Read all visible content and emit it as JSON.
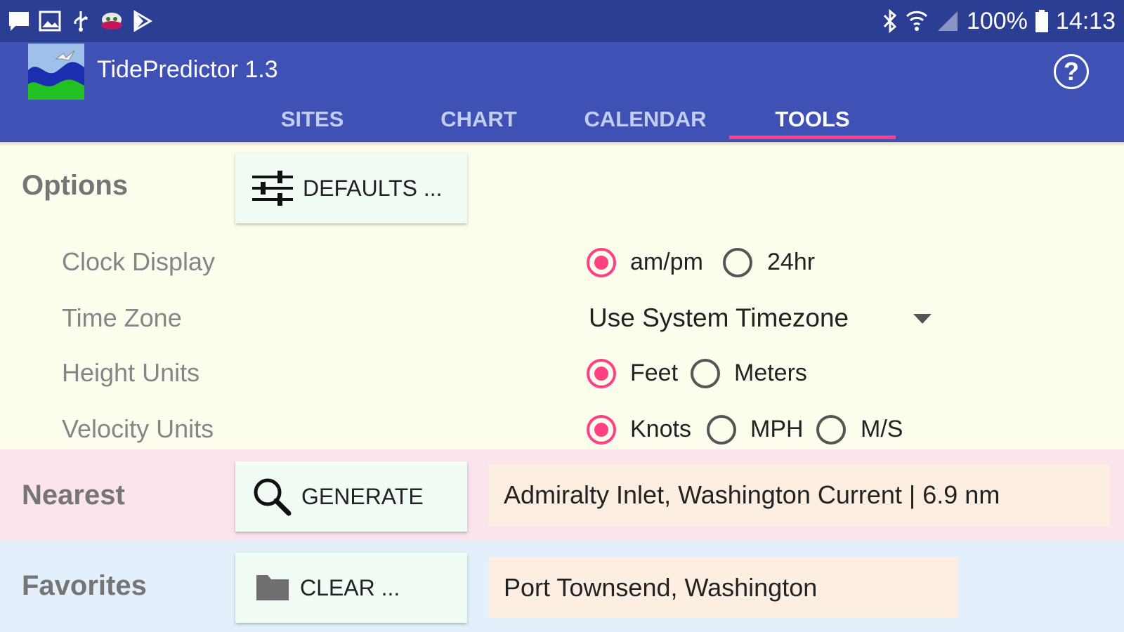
{
  "status_bar": {
    "battery": "100%",
    "time": "14:13",
    "left_icons": [
      "chat-icon",
      "image-icon",
      "usb-icon",
      "android-icon",
      "play-icon"
    ],
    "right_icons": [
      "bluetooth-icon",
      "wifi-icon",
      "signal-icon",
      "battery-icon"
    ]
  },
  "app_bar": {
    "title": "TidePredictor 1.3",
    "help_label": "?"
  },
  "tabs": [
    {
      "label": "SITES",
      "active": false
    },
    {
      "label": "CHART",
      "active": false
    },
    {
      "label": "CALENDAR",
      "active": false
    },
    {
      "label": "TOOLS",
      "active": true
    }
  ],
  "options": {
    "title": "Options",
    "defaults_button": "DEFAULTS ...",
    "clock_display": {
      "label": "Clock Display",
      "options": [
        "am/pm",
        "24hr"
      ],
      "selected": "am/pm"
    },
    "time_zone": {
      "label": "Time Zone",
      "value": "Use System Timezone"
    },
    "height_units": {
      "label": "Height Units",
      "options": [
        "Feet",
        "Meters"
      ],
      "selected": "Feet"
    },
    "velocity_units": {
      "label": "Velocity Units",
      "options": [
        "Knots",
        "MPH",
        "M/S"
      ],
      "selected": "Knots"
    }
  },
  "nearest": {
    "title": "Nearest",
    "button": "GENERATE",
    "result": "Admiralty Inlet, Washington Current | 6.9 nm"
  },
  "favorites": {
    "title": "Favorites",
    "button": "CLEAR ...",
    "result": "Port Townsend, Washington"
  },
  "colors": {
    "status_bar": "#2c3e94",
    "app_bar": "#3f51b5",
    "accent": "#ff4081",
    "options_bg": "#fdfdee",
    "nearest_bg": "#fce4ec",
    "favorites_bg": "#e3f0fb",
    "result_bg": "#fdeee2"
  }
}
